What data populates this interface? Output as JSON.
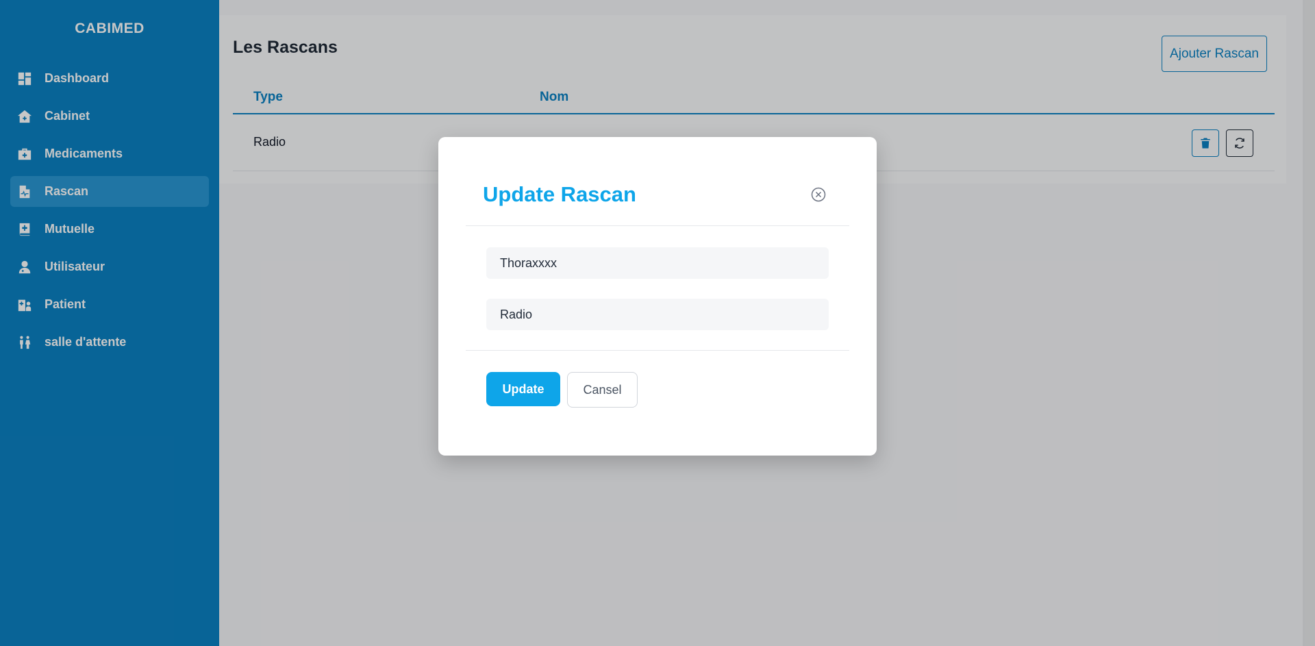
{
  "sidebar": {
    "brand": "CABIMED",
    "items": [
      {
        "label": "Dashboard",
        "icon": "dashboard-icon",
        "active": false
      },
      {
        "label": "Cabinet",
        "icon": "house-medical-icon",
        "active": false
      },
      {
        "label": "Medicaments",
        "icon": "medkit-icon",
        "active": false
      },
      {
        "label": "Rascan",
        "icon": "file-medical-icon",
        "active": true
      },
      {
        "label": "Mutuelle",
        "icon": "book-medical-icon",
        "active": false
      },
      {
        "label": "Utilisateur",
        "icon": "user-doctor-icon",
        "active": false
      },
      {
        "label": "Patient",
        "icon": "hospital-user-icon",
        "active": false
      },
      {
        "label": "salle d'attente",
        "icon": "people-icon",
        "active": false
      }
    ]
  },
  "main": {
    "title": "Les Rascans",
    "add_button": "Ajouter Rascan",
    "table": {
      "columns": [
        "Type",
        "Nom"
      ],
      "rows": [
        {
          "type": "Radio",
          "nom": ""
        }
      ]
    }
  },
  "modal": {
    "title": "Update Rascan",
    "nom_value": "Thoraxxxx",
    "type_value": "Radio",
    "update_label": "Update",
    "cancel_label": "Cansel"
  },
  "colors": {
    "sidebar": "#0b80c2",
    "accent": "#0ea5e9",
    "active_item": "#2a97d2"
  }
}
